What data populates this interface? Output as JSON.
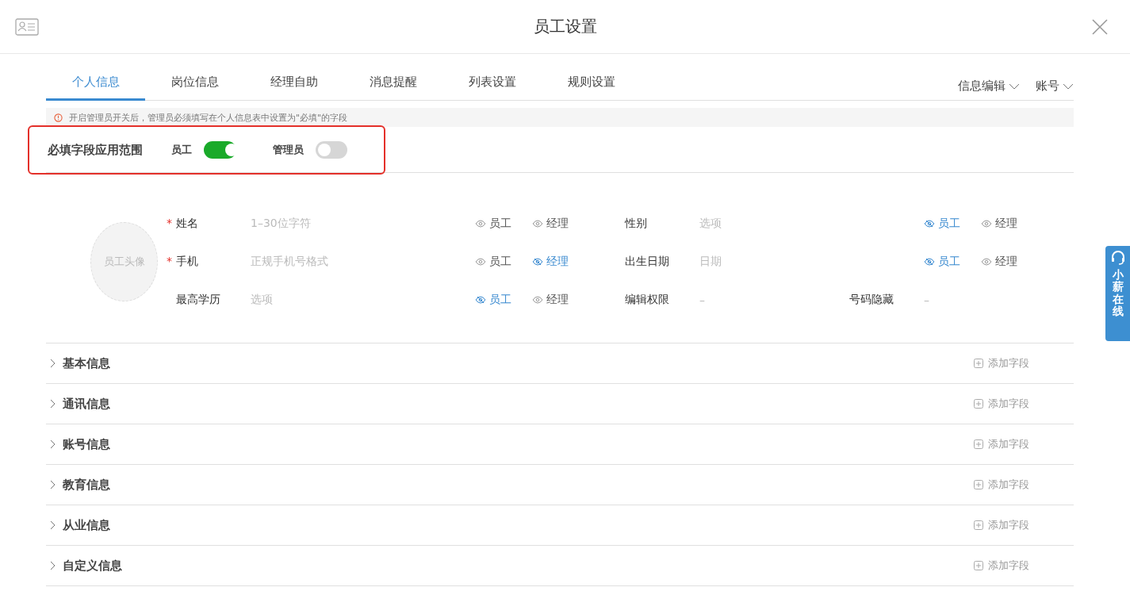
{
  "window": {
    "title": "员工设置"
  },
  "tabs": [
    {
      "label": "个人信息",
      "selected": true
    },
    {
      "label": "岗位信息",
      "selected": false
    },
    {
      "label": "经理自助",
      "selected": false
    },
    {
      "label": "消息提醒",
      "selected": false
    },
    {
      "label": "列表设置",
      "selected": false
    },
    {
      "label": "规则设置",
      "selected": false
    }
  ],
  "menus": [
    "信息编辑",
    "账号"
  ],
  "notice": "开启管理员开关后，管理员必须填写在个人信息表中设置为\"必填\"的字段",
  "scope": {
    "title": "必填字段应用范围",
    "highlighted": true,
    "switches": [
      {
        "label": "员工",
        "on": true
      },
      {
        "label": "管理员",
        "on": false
      }
    ]
  },
  "profile": {
    "avatar_label": "员工头像",
    "rows": [
      [
        [
          {
            "label": "姓名",
            "required_mark": "*",
            "value": "1–30位字符",
            "visibility": [
              {
                "label": "员工",
                "hidden": false
              },
              {
                "label": "经理",
                "hidden": false
              }
            ]
          }
        ],
        [
          {
            "label": "性别",
            "value": "选项",
            "visibility": [
              {
                "label": "员工",
                "hidden": true
              },
              {
                "label": "经理",
                "hidden": false
              }
            ]
          }
        ]
      ],
      [
        [
          {
            "label": "手机",
            "required_mark": "*",
            "value": "正规手机号格式",
            "visibility": [
              {
                "label": "员工",
                "hidden": false
              },
              {
                "label": "经理",
                "hidden": true
              }
            ]
          }
        ],
        [
          {
            "label": "出生日期",
            "value": "日期",
            "visibility": [
              {
                "label": "员工",
                "hidden": true
              },
              {
                "label": "经理",
                "hidden": false
              }
            ]
          }
        ]
      ],
      [
        [
          {
            "label": "最高学历",
            "value": "选项",
            "visibility": [
              {
                "label": "员工",
                "hidden": true
              },
              {
                "label": "经理",
                "hidden": false
              }
            ]
          }
        ],
        [
          {
            "label": "编辑权限",
            "value": "–"
          },
          {
            "label": "号码隐藏",
            "value": "–"
          }
        ]
      ]
    ]
  },
  "sections": [
    {
      "label": "基本信息",
      "expanded": false,
      "action": "添加字段"
    },
    {
      "label": "通讯信息",
      "expanded": false,
      "action": "添加字段"
    },
    {
      "label": "账号信息",
      "expanded": false,
      "action": "添加字段"
    },
    {
      "label": "教育信息",
      "expanded": false,
      "action": "添加字段"
    },
    {
      "label": "从业信息",
      "expanded": false,
      "action": "添加字段"
    },
    {
      "label": "自定义信息",
      "expanded": false,
      "action": "添加字段"
    }
  ],
  "support_widget": {
    "label": "小薪在线"
  }
}
